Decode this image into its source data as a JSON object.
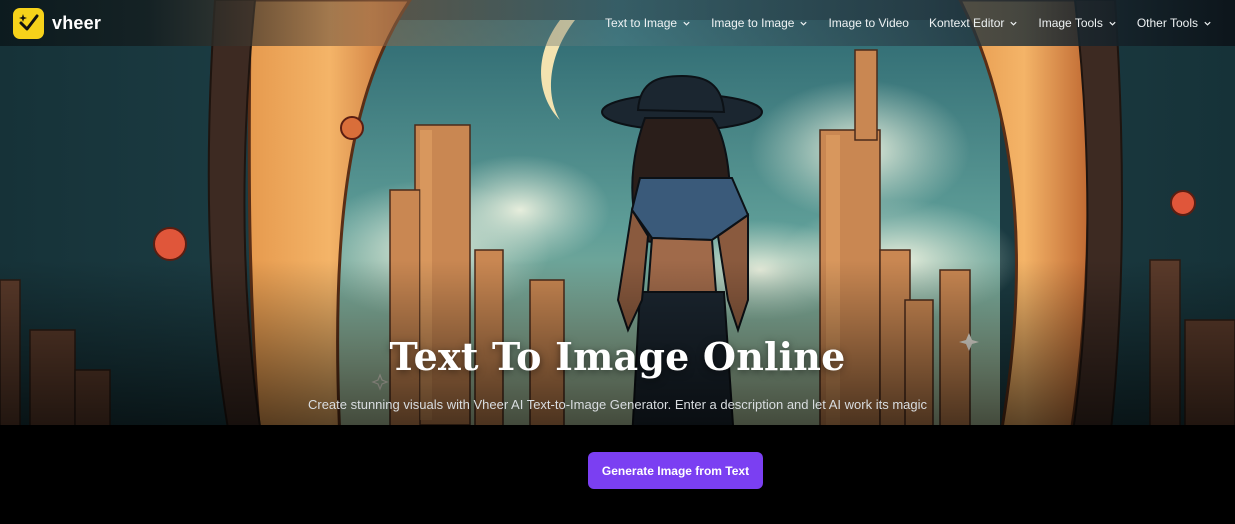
{
  "brand": {
    "name": "vheer",
    "logo_icon": "checkmark-star-icon",
    "logo_color": "#f6d21a"
  },
  "nav": {
    "items": [
      {
        "label": "Text to Image",
        "has_dropdown": true
      },
      {
        "label": "Image to Image",
        "has_dropdown": true
      },
      {
        "label": "Image to Video",
        "has_dropdown": false
      },
      {
        "label": "Kontext Editor",
        "has_dropdown": true
      },
      {
        "label": "Image Tools",
        "has_dropdown": true
      },
      {
        "label": "Other Tools",
        "has_dropdown": true
      }
    ]
  },
  "hero": {
    "title": "Text To Image Online",
    "subtitle": "Create stunning visuals with Vheer AI Text-to-Image Generator. Enter a description and let AI work its magic",
    "cta_label": "Generate Image from Text",
    "cta_color": "#7b3ff2"
  }
}
